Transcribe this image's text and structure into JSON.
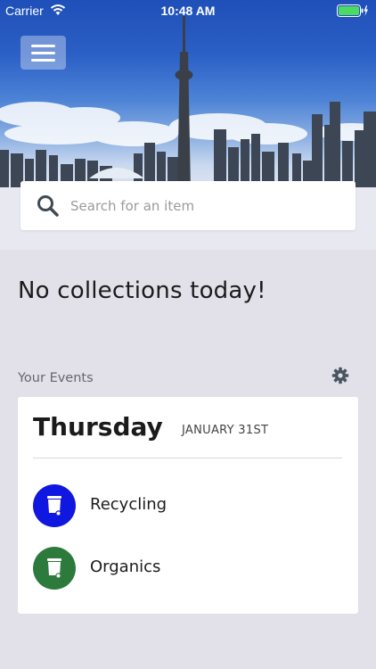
{
  "status_bar": {
    "carrier": "Carrier",
    "time": "10:48 AM"
  },
  "search": {
    "placeholder": "Search for an item"
  },
  "main": {
    "message": "No collections today!"
  },
  "events": {
    "label": "Your Events",
    "day": "Thursday",
    "date": "JANUARY 31ST",
    "items": [
      {
        "label": "Recycling",
        "icon": "bin-icon",
        "color": "#0f17e0"
      },
      {
        "label": "Organics",
        "icon": "bin-icon",
        "color": "#2d7a3d"
      }
    ]
  }
}
